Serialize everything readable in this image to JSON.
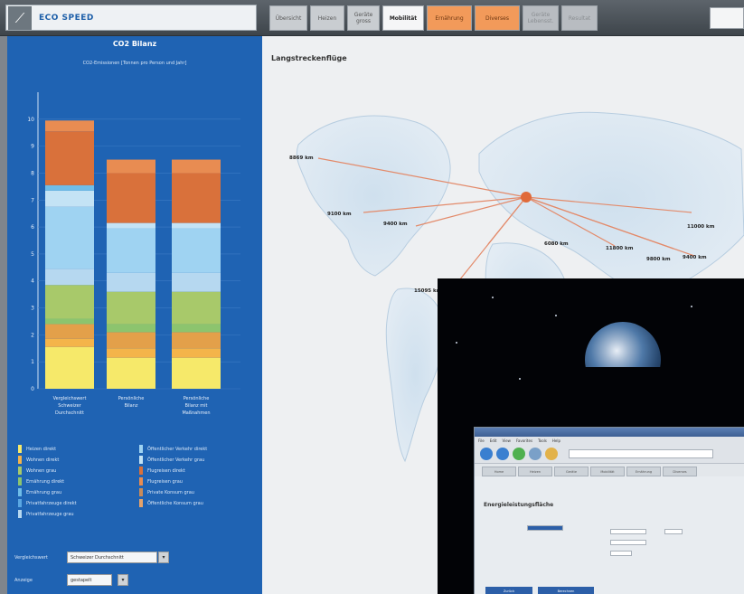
{
  "header": {
    "logo_text": "ECO SPEED",
    "tabs": [
      {
        "label": "Übersicht",
        "state": "normal"
      },
      {
        "label": "Heizen",
        "state": "normal"
      },
      {
        "label": "Geräte gross",
        "state": "normal"
      },
      {
        "label": "Mobilität",
        "state": "active"
      },
      {
        "label": "Ernährung",
        "state": "orange"
      },
      {
        "label": "Diverses",
        "state": "orange"
      },
      {
        "label": "Geräte Lebensst.",
        "state": "dim"
      },
      {
        "label": "Resultat",
        "state": "dim"
      }
    ]
  },
  "left_panel": {
    "title": "CO2 Bilanz",
    "subtitle": "CO2-Emissionen [Tonnen pro Person und Jahr]",
    "legend": [
      {
        "label": "Heizen direkt",
        "color": "#f6e96a"
      },
      {
        "label": "Öffentlicher Verkehr direkt",
        "color": "#9fd3f2"
      },
      {
        "label": "Wohnen direkt",
        "color": "#f4b44a"
      },
      {
        "label": "Öffentlicher Verkehr grau",
        "color": "#c4e3f5"
      },
      {
        "label": "Wohnen grau",
        "color": "#a8c96a"
      },
      {
        "label": "Flugreisen direkt",
        "color": "#d9713b"
      },
      {
        "label": "Ernährung direkt",
        "color": "#8cc46e"
      },
      {
        "label": "Flugreisen grau",
        "color": "#e88c52"
      },
      {
        "label": "Ernährung grau",
        "color": "#6fbde8"
      },
      {
        "label": "Private Konsum grau",
        "color": "#c98b5a"
      },
      {
        "label": "Privatfahrzeuge direkt",
        "color": "#5aa7e3"
      },
      {
        "label": "Öffentliche Konsum grau",
        "color": "#e6a36b"
      },
      {
        "label": "Privatfahrzeuge grau",
        "color": "#b6d8f0"
      }
    ],
    "comparison_label": "Vergleichswert",
    "comparison_value": "Schweizer Durchschnitt",
    "storage_label": "Anzeige",
    "storage_value": "gestapelt"
  },
  "chart_data": {
    "type": "bar",
    "stacked": true,
    "title": "CO2 Bilanz",
    "ylabel": "CO2-Emissionen [Tonnen pro Person und Jahr]",
    "ylim": [
      0,
      11
    ],
    "yticks": [
      0,
      1,
      2,
      3,
      4,
      5,
      6,
      7,
      8,
      9,
      10
    ],
    "categories": [
      "Vergleichswert Schweizer Durchschnitt",
      "Persönliche Bilanz",
      "Persönliche Bilanz mit Maßnahmen"
    ],
    "series": [
      {
        "color": "#f6e96a",
        "values": [
          1.55,
          1.15,
          1.15
        ]
      },
      {
        "color": "#f4b44a",
        "values": [
          0.3,
          0.35,
          0.35
        ]
      },
      {
        "color": "#e3a04a",
        "values": [
          0.55,
          0.6,
          0.6
        ]
      },
      {
        "color": "#8cc46e",
        "values": [
          0.2,
          0.3,
          0.3
        ]
      },
      {
        "color": "#a8c96a",
        "values": [
          1.25,
          1.2,
          1.2
        ]
      },
      {
        "color": "#b6d8f0",
        "values": [
          0.6,
          0.7,
          0.7
        ]
      },
      {
        "color": "#9fd3f2",
        "values": [
          2.3,
          1.65,
          1.65
        ]
      },
      {
        "color": "#c4e3f5",
        "values": [
          0.6,
          0.2,
          0.2
        ]
      },
      {
        "color": "#6fbde8",
        "values": [
          0.2,
          0.0,
          0.0
        ]
      },
      {
        "color": "#d9713b",
        "values": [
          2.0,
          1.85,
          1.85
        ]
      },
      {
        "color": "#e88c52",
        "values": [
          0.4,
          0.5,
          0.5
        ]
      }
    ]
  },
  "main": {
    "title": "Langstreckenflüge",
    "distances": [
      "8869 km",
      "9100 km",
      "9400 km",
      "15095 km",
      "6080 km",
      "11800 km",
      "9800 km",
      "9400 km",
      "11000 km"
    ]
  },
  "overlay": {
    "heading": "Energieleistungsfläche",
    "menus": [
      "File",
      "Edit",
      "View",
      "Favorites",
      "Tools",
      "Help"
    ],
    "tabs": [
      "Home",
      "Heizen",
      "Geräte",
      "Mobilität",
      "Ernährung",
      "Diverses"
    ],
    "action_1": "Zurück",
    "action_2": "Berechnen"
  }
}
